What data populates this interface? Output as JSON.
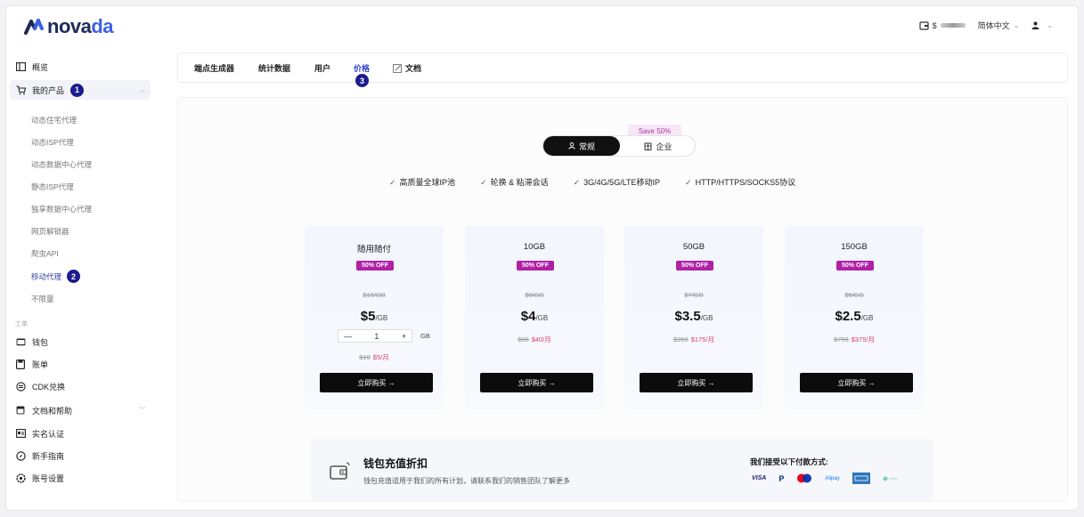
{
  "brand": {
    "logo_text_a": "nova",
    "logo_text_b": "da"
  },
  "topbar": {
    "balance_prefix": "$",
    "language": "简体中文"
  },
  "sidebar": {
    "overview": "概览",
    "my_products": "我的产品",
    "products": [
      "动态住宅代理",
      "动态ISP代理",
      "动态数据中心代理",
      "静态ISP代理",
      "独享数据中心代理",
      "网页解锁器",
      "爬虫API",
      "移动代理",
      "不限量"
    ],
    "section_label": "工单",
    "wallet": "钱包",
    "bills": "账单",
    "cdk": "CDK兑换",
    "docs_help": "文档和帮助",
    "verify": "实名认证",
    "guide": "新手指南",
    "account_settings": "账号设置",
    "step1": "1",
    "step2": "2"
  },
  "tabs": {
    "endpoint": "端点生成器",
    "stats": "统计数据",
    "users": "用户",
    "pricing": "价格",
    "docs": "文档",
    "step3": "3"
  },
  "plan_toggle": {
    "regular": "常规",
    "enterprise": "企业",
    "save_tag": "Save 50%"
  },
  "features": [
    "高质量全球IP池",
    "轮换 & 粘滞会话",
    "3G/4G/5G/LTE移动IP",
    "HTTP/HTTPS/SOCKS5协议"
  ],
  "cards": [
    {
      "title": "随用随付",
      "off": "50% OFF",
      "orig": "$10/GB",
      "price": "$5",
      "unit": "/GB",
      "sub_orig": "$10",
      "sub_price": "$5/月",
      "qty": "1",
      "qty_unit": "GB",
      "buy": "立即购买 →"
    },
    {
      "title": "10GB",
      "off": "50% OFF",
      "orig": "$8/GB",
      "price": "$4",
      "unit": "/GB",
      "sub_orig": "$80",
      "sub_price": "$40/月",
      "buy": "立即购买 →"
    },
    {
      "title": "50GB",
      "off": "50% OFF",
      "orig": "$7/GB",
      "price": "$3.5",
      "unit": "/GB",
      "sub_orig": "$350",
      "sub_price": "$175/月",
      "buy": "立即购买 →"
    },
    {
      "title": "150GB",
      "off": "50% OFF",
      "orig": "$5/GB",
      "price": "$2.5",
      "unit": "/GB",
      "sub_orig": "$750",
      "sub_price": "$375/月",
      "buy": "立即购买 →"
    }
  ],
  "wallet_promo": {
    "title": "钱包充值折扣",
    "desc": "钱包充值适用于我们的所有计划，请联系我们的销售团队了解更多",
    "pay_title": "我们接受以下付款方式:",
    "visa": "VISA",
    "paypal": "P",
    "alipay": "Alipay"
  },
  "colors": {
    "accent": "#3547c8",
    "off_badge": "#b020a8",
    "buy_btn": "#0c0c0c",
    "step_badge": "#1c1c8c"
  }
}
